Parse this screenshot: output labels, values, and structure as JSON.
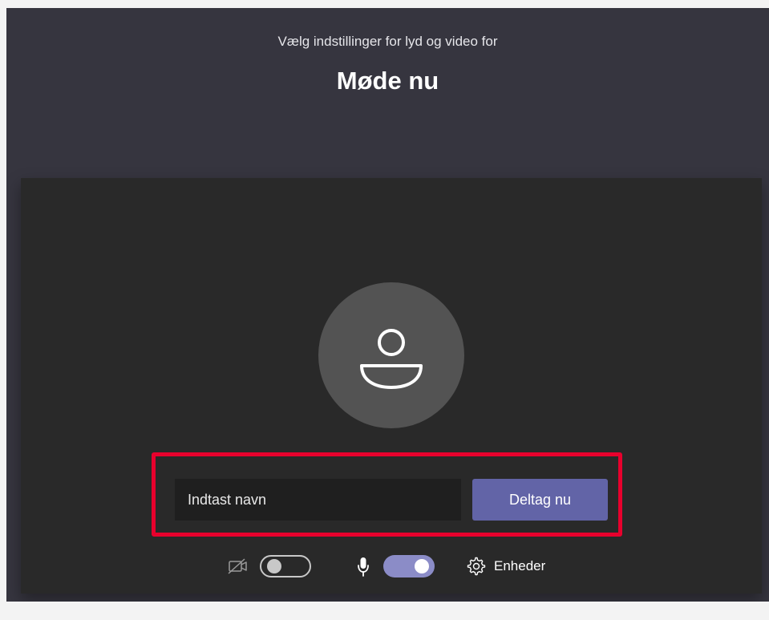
{
  "header": {
    "subtitle": "Vælg indstillinger for lyd og video for",
    "meeting_title": "Møde nu"
  },
  "join": {
    "name_placeholder": "Indtast navn",
    "name_value": "",
    "join_label": "Deltag nu"
  },
  "controls": {
    "camera_icon": "camera-off-icon",
    "camera_on": false,
    "mic_icon": "microphone-icon",
    "mic_on": true,
    "devices_icon": "gear-icon",
    "devices_label": "Enheder"
  },
  "colors": {
    "accent": "#6264a7",
    "highlight": "#e8002d",
    "toggle_on": "#8b8cc7",
    "background": "#36353f",
    "preview": "#292929"
  }
}
